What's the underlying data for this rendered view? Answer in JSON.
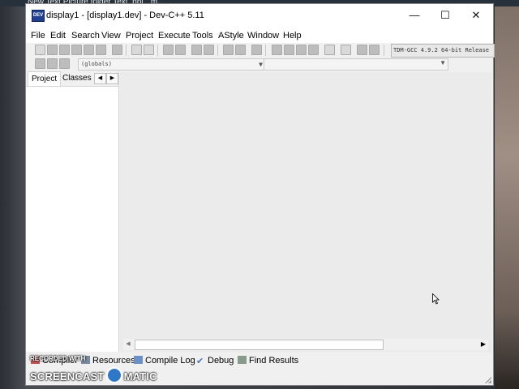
{
  "desktop": {
    "top_text": "New Text      Picture folder   Text_pp(_ m..."
  },
  "window": {
    "title": "display1 - [display1.dev] - Dev-C++ 5.11",
    "icon_text": "DEV",
    "controls": {
      "minimize": "—",
      "maximize": "☐",
      "close": "✕"
    }
  },
  "menu": [
    "File",
    "Edit",
    "Search",
    "View",
    "Project",
    "Execute",
    "Tools",
    "AStyle",
    "Window",
    "Help"
  ],
  "toolbar": {
    "compiler": "TDM-GCC 4.9.2 64-bit Release",
    "scope_combo": "(globals)",
    "function_combo": ""
  },
  "left_panel": {
    "tabs": [
      "Project",
      "Classes"
    ],
    "active_tab": "Project",
    "nav_prev": "◀",
    "nav_next": "▶"
  },
  "scrollbar": {
    "left_arrow": "◀",
    "right_arrow": "▶"
  },
  "bottom_tabs": [
    "Compiler",
    "Resources",
    "Compile Log",
    "Debug",
    "Find Results"
  ],
  "watermark": {
    "line1": "RECORDED WITH",
    "line2a": "SCREENCAST",
    "line2b": "MATIC"
  },
  "colors": {
    "accent": "#1f3f8f",
    "editor_bg": "#ebebeb"
  }
}
